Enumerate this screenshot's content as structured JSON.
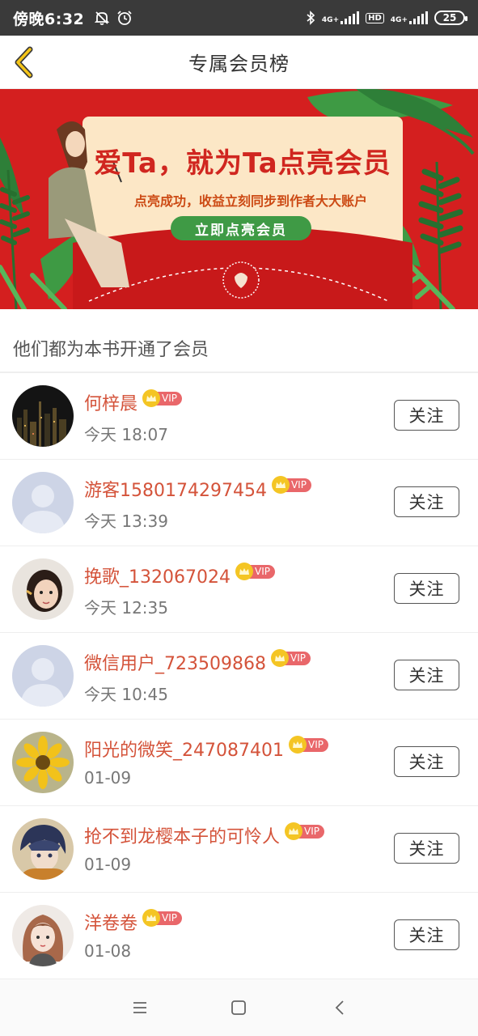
{
  "status_bar": {
    "time": "傍晚6:32",
    "network_1": "4G+",
    "network_2": "4G+",
    "hd_label": "HD",
    "battery": "25"
  },
  "header": {
    "title": "专属会员榜",
    "back_icon": "chevron-left-icon"
  },
  "banner": {
    "title": "爱Ta，就为Ta点亮会员",
    "subtitle": "点亮成功，收益立刻同步到作者大大账户",
    "cta_label": "立即点亮会员",
    "colors": {
      "background": "#d41f1f",
      "card": "#fce7c6",
      "cta": "#3f9a45"
    }
  },
  "section": {
    "title": "他们都为本书开通了会员"
  },
  "members": [
    {
      "name": "何梓晨",
      "time": "今天 18:07",
      "badge": "VIP",
      "follow_label": "关注",
      "avatar": "city-night-avatar"
    },
    {
      "name": "游客1580174297454",
      "time": "今天 13:39",
      "badge": "VIP",
      "follow_label": "关注",
      "avatar": "default-user-avatar"
    },
    {
      "name": "挽歌_132067024",
      "time": "今天 12:35",
      "badge": "VIP",
      "follow_label": "关注",
      "avatar": "girl-photo-avatar"
    },
    {
      "name": "微信用户_723509868",
      "time": "今天 10:45",
      "badge": "VIP",
      "follow_label": "关注",
      "avatar": "default-user-avatar"
    },
    {
      "name": "阳光的微笑_247087401",
      "time": "01-09",
      "badge": "VIP",
      "follow_label": "关注",
      "avatar": "sunflower-avatar"
    },
    {
      "name": "抢不到龙樱本子的可怜人",
      "time": "01-09",
      "badge": "VIP",
      "follow_label": "关注",
      "avatar": "anime-boy-avatar"
    },
    {
      "name": "洋卷卷",
      "time": "01-08",
      "badge": "VIP",
      "follow_label": "关注",
      "avatar": "anime-girl-avatar"
    }
  ],
  "bottom_nav": {
    "menu_icon": "menu-icon",
    "home_icon": "home-square-icon",
    "back_icon": "back-chevron-icon"
  },
  "colors": {
    "name_color": "#d4533a",
    "vip_badge": "#e9676a",
    "crown": "#f4c524"
  }
}
